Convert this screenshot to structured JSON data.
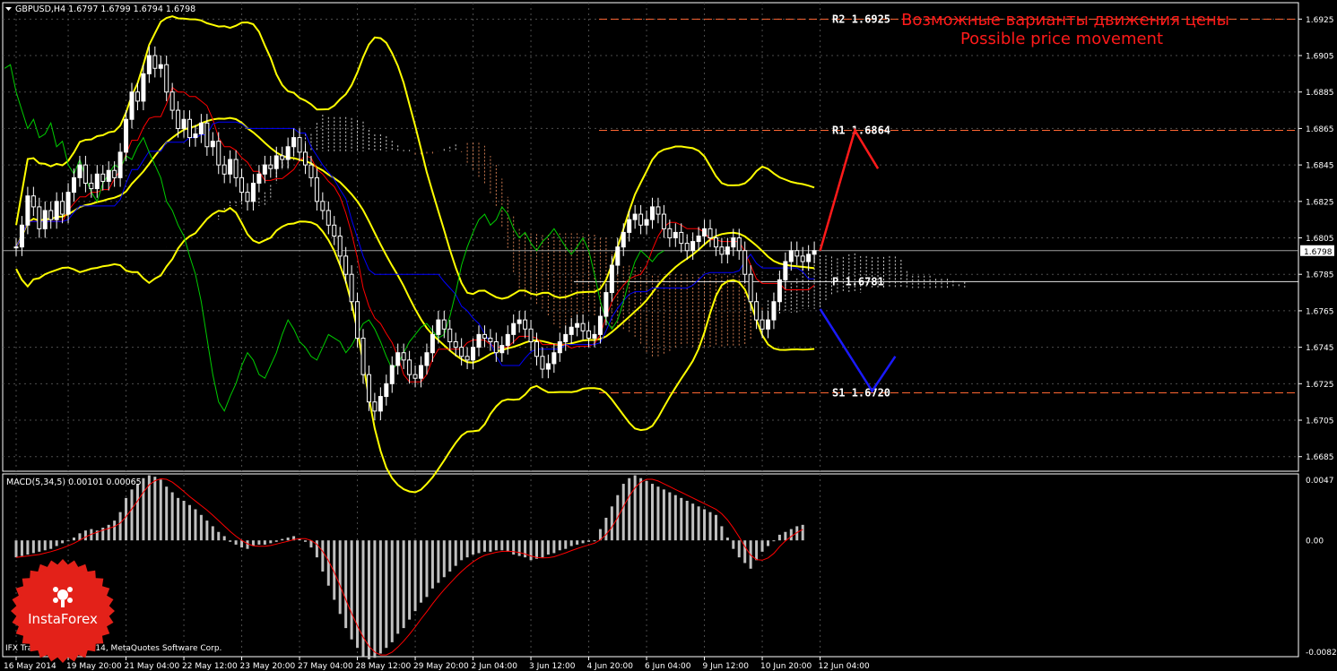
{
  "window": {
    "symbol_header": "GBPUSD,H4  1.6797 1.6799 1.6794 1.6798",
    "macd_header": "MACD(5,34,5) 0.00101 0.00065",
    "copyright": "IFX Trader, © 2001-2014, MetaQuotes Software Corp."
  },
  "annotations": {
    "title_ru": "Возможные варианты движения цены",
    "title_en": "Possible price movement",
    "logo_text": "InstaForex"
  },
  "colors": {
    "background": "#000000",
    "grid": "#4d4d4d",
    "axis": "#ffffff",
    "bollinger": "#ffff00",
    "tenkan": "#ff0000",
    "kijun": "#0000ff",
    "chikou": "#00cc00",
    "cloud_bull": "#ffffff",
    "cloud_bear": "#ff9966",
    "level_line": "#ff6633",
    "scenario_up": "#ff1a1a",
    "scenario_down": "#1a1aff",
    "macd_hist": "#c0c0c0",
    "macd_signal": "#ff0000",
    "logo": "#e32119"
  },
  "chart_data": {
    "type": "candlestick",
    "symbol": "GBPUSD",
    "timeframe": "H4",
    "ohlc_header": {
      "open": 1.6797,
      "high": 1.6799,
      "low": 1.6794,
      "close": 1.6798
    },
    "ylim": [
      1.6677,
      1.6934
    ],
    "y_ticks": [
      "1.6925",
      "1.6905",
      "1.6885",
      "1.6865",
      "1.6845",
      "1.6825",
      "1.6805",
      "1.6785",
      "1.6765",
      "1.6745",
      "1.6725",
      "1.6705",
      "1.6685"
    ],
    "current_price": {
      "label": "1.6798",
      "value": 1.6798
    },
    "x_ticks": [
      {
        "label": "16 May 2014",
        "bar": 0
      },
      {
        "label": "19 May 20:00",
        "bar": 9
      },
      {
        "label": "21 May 04:00",
        "bar": 19
      },
      {
        "label": "22 May 12:00",
        "bar": 29
      },
      {
        "label": "23 May 20:00",
        "bar": 39
      },
      {
        "label": "27 May 04:00",
        "bar": 49
      },
      {
        "label": "28 May 12:00",
        "bar": 59
      },
      {
        "label": "29 May 20:00",
        "bar": 69
      },
      {
        "label": "2 Jun 04:00",
        "bar": 79
      },
      {
        "label": "3 Jun 12:00",
        "bar": 89
      },
      {
        "label": "4 Jun 20:00",
        "bar": 99
      },
      {
        "label": "6 Jun 04:00",
        "bar": 109
      },
      {
        "label": "9 Jun 12:00",
        "bar": 119
      },
      {
        "label": "10 Jun 20:00",
        "bar": 129
      },
      {
        "label": "12 Jun 04:00",
        "bar": 139
      }
    ],
    "levels": [
      {
        "name": "R2",
        "label": "R2 1.6925",
        "value": 1.6925
      },
      {
        "name": "R1",
        "label": "R1 1.6864",
        "value": 1.6864
      },
      {
        "name": "P",
        "label": "P 1.6781",
        "value": 1.6781
      },
      {
        "name": "S1",
        "label": "S1 1.6720",
        "value": 1.672
      }
    ],
    "closes": [
      1.68,
      1.6812,
      1.6828,
      1.6822,
      1.681,
      1.682,
      1.6815,
      1.6825,
      1.6818,
      1.683,
      1.6838,
      1.6845,
      1.6835,
      1.6832,
      1.684,
      1.6836,
      1.6842,
      1.6838,
      1.6852,
      1.687,
      1.6885,
      1.688,
      1.6895,
      1.6905,
      1.6898,
      1.69,
      1.6885,
      1.6875,
      1.6865,
      1.687,
      1.686,
      1.6862,
      1.6868,
      1.6855,
      1.6858,
      1.6845,
      1.684,
      1.6848,
      1.6838,
      1.683,
      1.6825,
      1.6835,
      1.684,
      1.6845,
      1.6843,
      1.685,
      1.6848,
      1.6855,
      1.686,
      1.6852,
      1.6845,
      1.6838,
      1.6825,
      1.682,
      1.6812,
      1.6806,
      1.6795,
      1.6785,
      1.677,
      1.675,
      1.673,
      1.6715,
      1.671,
      1.6718,
      1.6725,
      1.6735,
      1.6742,
      1.6738,
      1.673,
      1.6728,
      1.6735,
      1.6742,
      1.6752,
      1.676,
      1.6755,
      1.6748,
      1.6745,
      1.674,
      1.6738,
      1.6745,
      1.6752,
      1.675,
      1.6748,
      1.6742,
      1.6746,
      1.6752,
      1.6758,
      1.676,
      1.6755,
      1.6748,
      1.674,
      1.6733,
      1.6736,
      1.6742,
      1.6748,
      1.6752,
      1.6756,
      1.6758,
      1.6754,
      1.675,
      1.6752,
      1.6762,
      1.6775,
      1.679,
      1.68,
      1.6808,
      1.6815,
      1.6818,
      1.6812,
      1.6815,
      1.6822,
      1.6818,
      1.681,
      1.6805,
      1.6808,
      1.6802,
      1.6798,
      1.6803,
      1.6806,
      1.681,
      1.6805,
      1.68,
      1.6796,
      1.68,
      1.6805,
      1.6798,
      1.6785,
      1.677,
      1.676,
      1.6755,
      1.676,
      1.677,
      1.6782,
      1.6792,
      1.6798,
      1.6795,
      1.6792,
      1.6796,
      1.6798
    ],
    "scenarios": [
      {
        "name": "up",
        "points": [
          [
            139,
            1.6798
          ],
          [
            145,
            1.6864
          ],
          [
            149,
            1.6843
          ]
        ]
      },
      {
        "name": "down",
        "points": [
          [
            139,
            1.6766
          ],
          [
            148,
            1.6721
          ],
          [
            152,
            1.674
          ]
        ]
      }
    ],
    "macd": {
      "ylim": [
        -0.00822,
        0.0047
      ],
      "y_ticks": [
        "0.0047",
        "0.00",
        "-0.00822"
      ],
      "current": {
        "macd": 0.00101,
        "signal": 0.00065
      },
      "histogram": [
        -0.0012,
        -0.0011,
        -0.001,
        -0.0009,
        -0.0008,
        -0.0007,
        -0.0006,
        -0.0004,
        -0.0002,
        0.0,
        0.0002,
        0.0005,
        0.0007,
        0.0008,
        0.0007,
        0.0009,
        0.0011,
        0.0014,
        0.002,
        0.003,
        0.0036,
        0.004,
        0.0044,
        0.0046,
        0.0045,
        0.0043,
        0.0038,
        0.0034,
        0.003,
        0.0028,
        0.0025,
        0.0022,
        0.0018,
        0.0014,
        0.001,
        0.0006,
        0.0003,
        -0.0001,
        -0.0003,
        -0.0005,
        -0.0006,
        -0.0004,
        -0.0003,
        -0.0003,
        -0.0002,
        -0.0001,
        0.0001,
        0.0002,
        0.0003,
        0.0001,
        -0.0001,
        -0.0005,
        -0.0012,
        -0.0022,
        -0.0032,
        -0.0042,
        -0.0052,
        -0.0062,
        -0.007,
        -0.0076,
        -0.0082,
        -0.0084,
        -0.0083,
        -0.008,
        -0.0076,
        -0.0072,
        -0.0066,
        -0.0062,
        -0.0056,
        -0.005,
        -0.0044,
        -0.004,
        -0.0034,
        -0.003,
        -0.0026,
        -0.0022,
        -0.0018,
        -0.0014,
        -0.0012,
        -0.001,
        -0.0009,
        -0.0008,
        -0.0008,
        -0.0007,
        -0.0007,
        -0.0008,
        -0.001,
        -0.0011,
        -0.0012,
        -0.0014,
        -0.0013,
        -0.0012,
        -0.001,
        -0.0009,
        -0.0007,
        -0.0006,
        -0.0004,
        -0.0003,
        -0.0002,
        -0.0001,
        0.0,
        0.0008,
        0.0016,
        0.0024,
        0.0032,
        0.004,
        0.0044,
        0.0046,
        0.0044,
        0.0042,
        0.004,
        0.0038,
        0.0036,
        0.0034,
        0.0032,
        0.003,
        0.0028,
        0.0026,
        0.0024,
        0.0022,
        0.002,
        0.0018,
        0.001,
        0.0002,
        -0.0006,
        -0.0012,
        -0.0016,
        -0.002,
        -0.0014,
        -0.0008,
        -0.0004,
        0.0,
        0.0004,
        0.0006,
        0.0008,
        0.001,
        0.0011
      ]
    }
  }
}
